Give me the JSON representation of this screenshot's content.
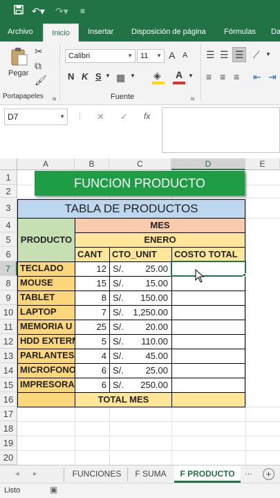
{
  "qat": {
    "save_icon": "save-icon",
    "undo_icon": "undo-icon",
    "redo_icon": "redo-icon",
    "customize_icon": "customize-icon",
    "undo_glyph": "↶▾",
    "redo_glyph": "↷▾",
    "customize_glyph": "≡"
  },
  "tabs": [
    "Archivo",
    "Inicio",
    "Insertar",
    "Disposición de página",
    "Fórmulas",
    "Da"
  ],
  "ribbon": {
    "clipboard_group": "Portapapeles",
    "paste_label": "Pegar",
    "font_group": "Fuente",
    "font_name": "Calibri",
    "font_size": "11",
    "bold": "N",
    "italic": "K",
    "underline": "S",
    "font_color_letter": "A",
    "grow_font": "A",
    "shrink_font": "A",
    "fill_color": "#ffd700",
    "font_color": "#e03030"
  },
  "formula_bar": {
    "name_box": "D7",
    "cancel": "✕",
    "confirm": "✓",
    "fx": "fx",
    "formula": ""
  },
  "columns": [
    "A",
    "B",
    "C",
    "D",
    "E"
  ],
  "rows": [
    "1",
    "2",
    "3",
    "4",
    "5",
    "6",
    "7",
    "8",
    "9",
    "10",
    "11",
    "12",
    "13",
    "14",
    "15",
    "16",
    "17",
    "18",
    "19",
    "20"
  ],
  "selected": {
    "col": "D",
    "row": "7"
  },
  "banner": {
    "text": "FUNCION PRODUCTO",
    "color": "#1e9d44"
  },
  "table": {
    "title": "TABLA DE PRODUCTOS",
    "header_product": "PRODUCTO",
    "header_month": "MES",
    "header_enero": "ENERO",
    "col_cant": "CANT",
    "col_cto": "CTO_UNIT",
    "col_costo": "COSTO TOTAL",
    "currency": "S/.",
    "total_label": "TOTAL MES",
    "items": [
      {
        "producto": "TECLADO",
        "cant": "12",
        "cto": "25.00"
      },
      {
        "producto": "MOUSE",
        "cant": "15",
        "cto": "15.00"
      },
      {
        "producto": "TABLET",
        "cant": "8",
        "cto": "150.00"
      },
      {
        "producto": "LAPTOP",
        "cant": "7",
        "cto": "1,250.00"
      },
      {
        "producto": "MEMORIA U",
        "cant": "25",
        "cto": "20.00"
      },
      {
        "producto": "HDD EXTERN",
        "cant": "5",
        "cto": "110.00"
      },
      {
        "producto": "PARLANTES",
        "cant": "4",
        "cto": "45.00"
      },
      {
        "producto": "MICROFONO",
        "cant": "6",
        "cto": "25.00"
      },
      {
        "producto": "IMPRESORA",
        "cant": "6",
        "cto": "250.00"
      }
    ]
  },
  "sheets": [
    "FUNCIONES",
    "F SUMA",
    "F PRODUCTO"
  ],
  "active_sheet": "F PRODUCTO",
  "status": {
    "text": "Listo"
  },
  "colors": {
    "excel_green": "#217346",
    "title_blue": "#bdd7ee",
    "product_green": "#c6e0b4",
    "orange": "#f8cbad",
    "yellow": "#ffe699",
    "product_cell": "#fbd67a"
  }
}
